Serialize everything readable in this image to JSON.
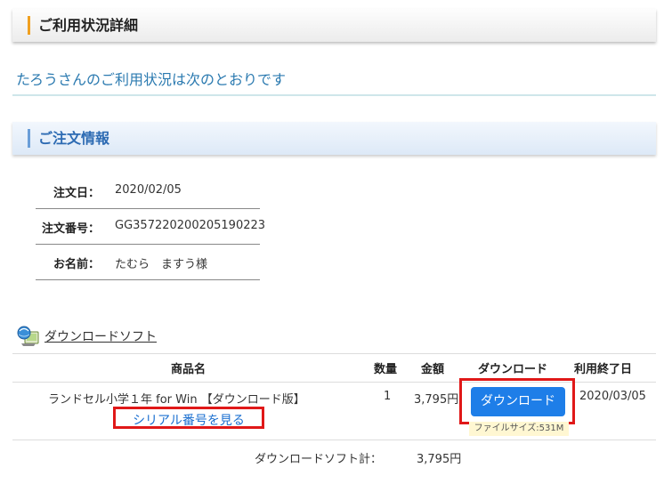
{
  "section": {
    "title": "ご利用状況詳細",
    "intro": "たろうさんのご利用状況は次のとおりです"
  },
  "order": {
    "title": "ご注文情報",
    "rows": [
      {
        "label": "注文日：",
        "value": "2020/02/05"
      },
      {
        "label": "注文番号：",
        "value": "GG357220200205190223"
      },
      {
        "label": "お名前：",
        "value": "たむら　ますう様"
      }
    ]
  },
  "download_software": {
    "heading": "ダウンロードソフト",
    "columns": [
      "商品名",
      "数量",
      "金額",
      "ダウンロード",
      "利用終了日"
    ],
    "items": [
      {
        "name": "ランドセル小学１年 for Win 【ダウンロード版】",
        "serial_link": "シリアル番号を見る",
        "quantity": "1",
        "price": "3,795円",
        "download_button": "ダウンロード",
        "file_size": "ファイルサイズ:531M",
        "end_date": "2020/03/05"
      }
    ],
    "total_label": "ダウンロードソフト計：",
    "total_value": "3,795円"
  },
  "colors": {
    "accent_orange": "#f0a020",
    "accent_blue": "#2d6bb3",
    "button_blue": "#1e7ee8",
    "highlight_red": "#e01818"
  }
}
